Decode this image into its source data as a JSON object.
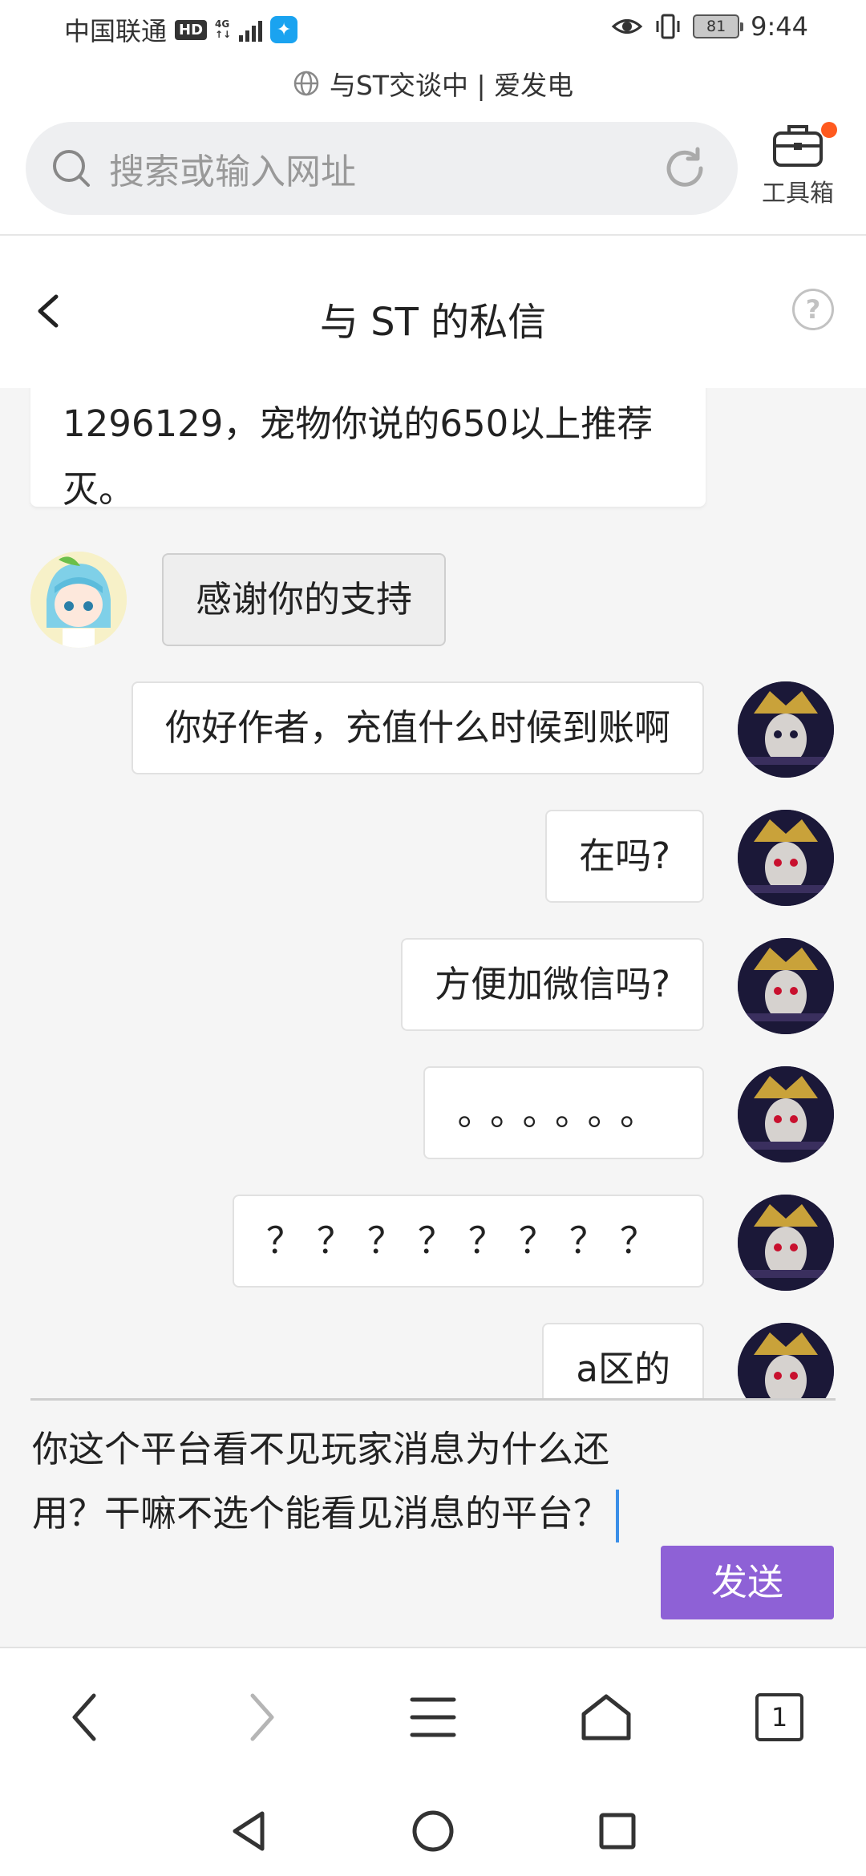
{
  "status_bar": {
    "carrier": "中国联通",
    "hd": "HD",
    "network": "4G",
    "battery": "81",
    "time": "9:44"
  },
  "browser": {
    "title": "与ST交谈中 | 爱发电",
    "search_placeholder": "搜索或输入网址",
    "toolbox_label": "工具箱"
  },
  "header": {
    "title": "与 ST 的私信",
    "help": "?"
  },
  "messages": {
    "partial_in": "1296129，宠物你说的650以上推荐灭。",
    "in_1": "感谢你的支持",
    "out_1": "你好作者，充值什么时候到账啊",
    "out_2": "在吗?",
    "out_3": "方便加微信吗?",
    "out_4": "。。。。。。",
    "out_5": "？？？？？？？？",
    "out_6": "a区的"
  },
  "composer": {
    "text": "你这个平台看不见玩家消息为什么还用？干嘛不选个能看见消息的平台？",
    "send_label": "发送"
  },
  "bottom_nav": {
    "tab_count": "1"
  },
  "colors": {
    "accent": "#8e61d6",
    "caret": "#3b8fe8",
    "badge_dot": "#ff5a1f"
  }
}
